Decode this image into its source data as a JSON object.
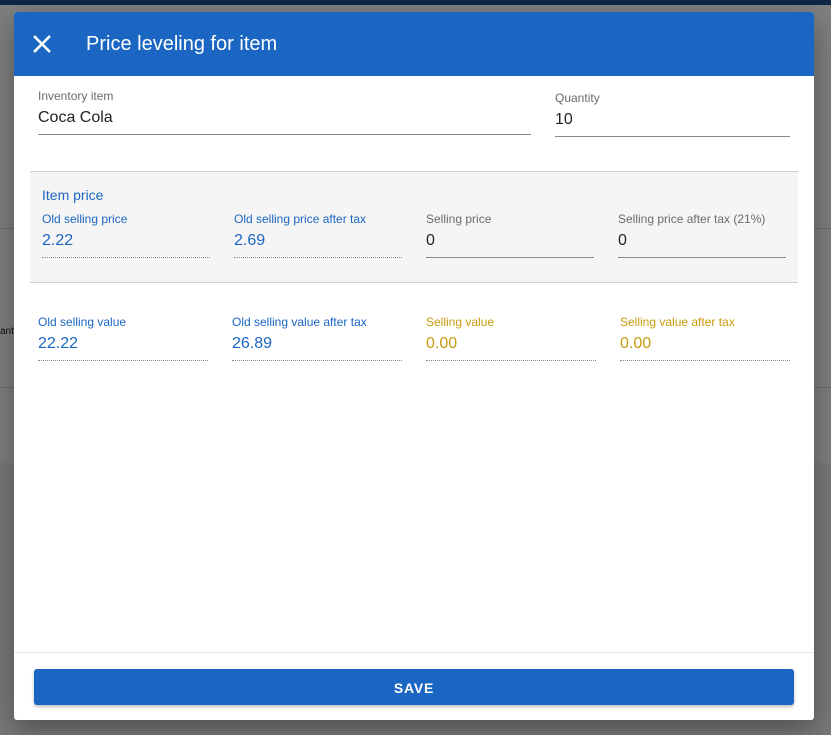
{
  "dialog": {
    "title": "Price leveling for item",
    "close_icon": "close-icon",
    "save_label": "SAVE"
  },
  "inventory_item": {
    "label": "Inventory item",
    "value": "Coca Cola"
  },
  "quantity": {
    "label": "Quantity",
    "value": "10"
  },
  "item_price": {
    "title": "Item price",
    "old_selling_price": {
      "label": "Old selling price",
      "value": "2.22"
    },
    "old_selling_price_after_tax": {
      "label": "Old selling price after tax",
      "value": "2.69"
    },
    "selling_price": {
      "label": "Selling price",
      "value": "0"
    },
    "selling_price_after_tax": {
      "label": "Selling price after tax (21%)",
      "value": "0"
    }
  },
  "values": {
    "old_selling_value": {
      "label": "Old selling value",
      "value": "22.22"
    },
    "old_selling_value_after_tax": {
      "label": "Old selling value after tax",
      "value": "26.89"
    },
    "selling_value": {
      "label": "Selling value",
      "value": "0.00"
    },
    "selling_value_after_tax": {
      "label": "Selling value after tax",
      "value": "0.00"
    }
  },
  "background": {
    "partial_text": "ant"
  },
  "colors": {
    "primary": "#1a66c2",
    "accent_gold": "#c99a0c",
    "header_text": "#ffffff"
  }
}
